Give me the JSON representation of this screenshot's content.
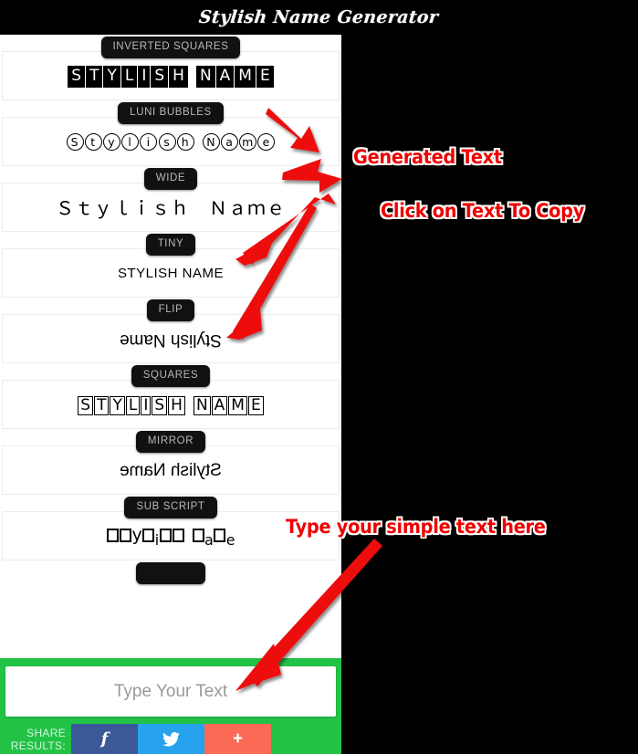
{
  "app": {
    "title": "Stylish Name Generator"
  },
  "styles": [
    {
      "label": "INVERTED SQUARES",
      "kind": "inverted-squares",
      "text": "STYLISH NAME",
      "words": [
        "STYLISH",
        "NAME"
      ]
    },
    {
      "label": "LUNI BUBBLES",
      "kind": "bubbles",
      "text": "Stylish Name",
      "words": [
        "Stylish",
        "Name"
      ]
    },
    {
      "label": "WIDE",
      "kind": "wide",
      "text": "Ｓｔｙｌｉｓｈ　Ｎａｍｅ"
    },
    {
      "label": "TINY",
      "kind": "tiny",
      "text": "sᴛʏʟɪsʜ ɴᴀᴍᴇ",
      "plain": "STYLISH NAME"
    },
    {
      "label": "FLIP",
      "kind": "flip",
      "text": "Stylish Name",
      "rendered": "ǝɯɐN ɥsᴉlʎʇS"
    },
    {
      "label": "SQUARES",
      "kind": "squares",
      "text": "STYLISH NAME",
      "words": [
        "STYLISH",
        "NAME"
      ]
    },
    {
      "label": "MIRROR",
      "kind": "mirror",
      "text": "Stylish Name",
      "rendered": "ǝmɒᴎ ʜƨilʏƚƧ"
    },
    {
      "label": "SUB SCRIPT",
      "kind": "subscript",
      "text": "□□y□ᵢ□□ □ₐ□ₑ"
    }
  ],
  "input": {
    "placeholder": "Type Your Text",
    "value": ""
  },
  "share": {
    "label_line1": "SHARE",
    "label_line2": "RESULTS:",
    "buttons": [
      {
        "name": "facebook",
        "glyph": "f",
        "color": "#3b5998"
      },
      {
        "name": "twitter",
        "glyph": "🐦",
        "color": "#27a2ec"
      },
      {
        "name": "more",
        "glyph": "+",
        "color": "#fa6a56"
      }
    ]
  },
  "annotations": [
    {
      "id": "generated",
      "text": "Generated Text"
    },
    {
      "id": "copy",
      "text": "Click on Text To Copy"
    },
    {
      "id": "type",
      "text": "Type your simple text here"
    }
  ],
  "colors": {
    "background": "#000000",
    "panel": "#ffffff",
    "footer_green": "#22c247",
    "badge": "#111111",
    "badge_text": "#b9b9b9",
    "annotation_red": "#ee0000"
  }
}
